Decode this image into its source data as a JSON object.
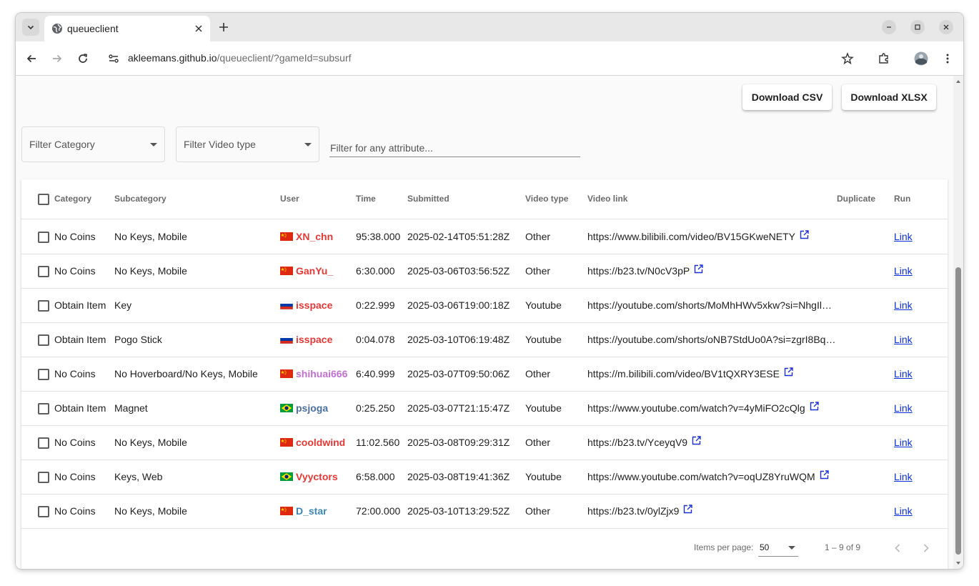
{
  "browser": {
    "tab_title": "queueclient",
    "url_host": "akleemans.github.io",
    "url_path": "/queueclient/?gameId=subsurf"
  },
  "actions": {
    "download_csv": "Download CSV",
    "download_xlsx": "Download XLSX"
  },
  "filters": {
    "category_placeholder": "Filter Category",
    "video_type_placeholder": "Filter Video type",
    "any_attribute_placeholder": "Filter for any attribute..."
  },
  "table": {
    "headers": {
      "category": "Category",
      "subcategory": "Subcategory",
      "user": "User",
      "time": "Time",
      "submitted": "Submitted",
      "video_type": "Video type",
      "video_link": "Video link",
      "duplicate": "Duplicate",
      "run": "Run"
    },
    "rows": [
      {
        "category": "No Coins",
        "subcategory": "No Keys, Mobile",
        "flag": "CN",
        "user": "XN_chn",
        "user_color": "#e53935",
        "time": "95:38.000",
        "submitted": "2025-02-14T05:51:28Z",
        "video_type": "Other",
        "video_link": "https://www.bilibili.com/video/BV15GKweNETY",
        "external": true,
        "run": "Link"
      },
      {
        "category": "No Coins",
        "subcategory": "No Keys, Mobile",
        "flag": "CN",
        "user": "GanYu_",
        "user_color": "#e53935",
        "time": "6:30.000",
        "submitted": "2025-03-06T03:56:52Z",
        "video_type": "Other",
        "video_link": "https://b23.tv/N0cV3pP",
        "external": true,
        "run": "Link"
      },
      {
        "category": "Obtain Item",
        "subcategory": "Key",
        "flag": "RU",
        "user": "isspace",
        "user_color": "#e53935",
        "time": "0:22.999",
        "submitted": "2025-03-06T19:00:18Z",
        "video_type": "Youtube",
        "video_link": "https://youtube.com/shorts/MoMhHWv5xkw?si=NhgIl…",
        "external": false,
        "run": "Link"
      },
      {
        "category": "Obtain Item",
        "subcategory": "Pogo Stick",
        "flag": "RU",
        "user": "isspace",
        "user_color": "#e53935",
        "time": "0:04.078",
        "submitted": "2025-03-10T06:19:48Z",
        "video_type": "Youtube",
        "video_link": "https://youtube.com/shorts/oNB7StdUo0A?si=zgrI8Bq…",
        "external": false,
        "run": "Link"
      },
      {
        "category": "No Coins",
        "subcategory": "No Hoverboard/No Keys, Mobile",
        "flag": "CN",
        "user": "shihuai666",
        "user_color": "#c36fd2",
        "time": "6:40.999",
        "submitted": "2025-03-07T09:50:06Z",
        "video_type": "Other",
        "video_link": "https://m.bilibili.com/video/BV1tQXRY3ESE",
        "external": true,
        "run": "Link"
      },
      {
        "category": "Obtain Item",
        "subcategory": "Magnet",
        "flag": "BR",
        "user": "psjoga",
        "user_color": "#4a6fa5",
        "time": "0:25.250",
        "submitted": "2025-03-07T21:15:47Z",
        "video_type": "Youtube",
        "video_link": "https://www.youtube.com/watch?v=4yMiFO2cQlg",
        "external": true,
        "run": "Link"
      },
      {
        "category": "No Coins",
        "subcategory": "No Keys, Mobile",
        "flag": "CN",
        "user": "cooldwind",
        "user_color": "#e53935",
        "time": "11:02.560",
        "submitted": "2025-03-08T09:29:31Z",
        "video_type": "Other",
        "video_link": "https://b23.tv/YceyqV9",
        "external": true,
        "run": "Link"
      },
      {
        "category": "No Coins",
        "subcategory": "Keys, Web",
        "flag": "BR",
        "user": "Vyyctors",
        "user_color": "#e53935",
        "time": "6:58.000",
        "submitted": "2025-03-08T19:41:36Z",
        "video_type": "Youtube",
        "video_link": "https://www.youtube.com/watch?v=oqUZ8YruWQM",
        "external": true,
        "run": "Link"
      },
      {
        "category": "No Coins",
        "subcategory": "No Keys, Mobile",
        "flag": "CN",
        "user": "D_star",
        "user_color": "#3a87b8",
        "time": "72:00.000",
        "submitted": "2025-03-10T13:29:52Z",
        "video_type": "Other",
        "video_link": "https://b23.tv/0ylZjx9",
        "external": true,
        "run": "Link"
      }
    ]
  },
  "paginator": {
    "items_per_page_label": "Items per page:",
    "page_size": "50",
    "range_label": "1 – 9 of 9"
  }
}
